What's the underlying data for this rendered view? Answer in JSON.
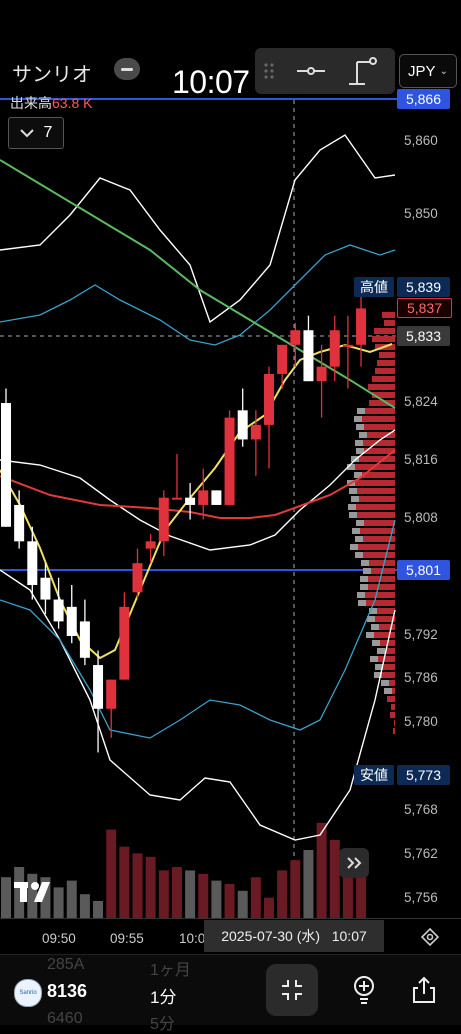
{
  "header": {
    "symbol_name": "サンリオ",
    "clock": "10:07",
    "currency": "JPY",
    "volume_label": "出来高",
    "volume_value": "63.8 K",
    "indicator_count": "7"
  },
  "price_axis": {
    "labels": [
      "5,860",
      "5,850",
      "5,824",
      "5,816",
      "5,808",
      "5,792",
      "5,786",
      "5,780",
      "5,768",
      "5,762",
      "5,756"
    ],
    "tags": {
      "upper_line": "5,866",
      "high": "5,839",
      "current": "5,837",
      "crosshair": "5,833",
      "lower_line": "5,801",
      "low": "5,773"
    },
    "high_label": "高値",
    "low_label": "安値"
  },
  "time_axis": {
    "labels": [
      "09:50",
      "09:55",
      "10:0"
    ],
    "crosshair": "2025-07-30 (水)   10:07"
  },
  "bottom_bar": {
    "stock_code": "8136",
    "interval": "1分",
    "ghost_above_code": "285A",
    "ghost_below_code": "6460",
    "ghost_above_interval": "1ヶ月",
    "ghost_below_interval": "5分"
  },
  "colors": {
    "up": "#e0323c",
    "down": "#ffffff",
    "line_blue": "#2f55e0",
    "ma_yellow": "#f0e060",
    "ma_red": "#e03a3a",
    "ma_green": "#5cb860",
    "bb_cyan": "#3aa0c8"
  },
  "chart_data": {
    "type": "candlestick",
    "interval": "1分",
    "candles": [
      {
        "o": 5824,
        "h": 5826,
        "l": 5809,
        "c": 5807
      },
      {
        "o": 5810,
        "h": 5812,
        "l": 5804,
        "c": 5805
      },
      {
        "o": 5805,
        "h": 5807,
        "l": 5797,
        "c": 5799
      },
      {
        "o": 5800,
        "h": 5802,
        "l": 5795,
        "c": 5797
      },
      {
        "o": 5797,
        "h": 5800,
        "l": 5793,
        "c": 5794
      },
      {
        "o": 5796,
        "h": 5799,
        "l": 5791,
        "c": 5792
      },
      {
        "o": 5794,
        "h": 5797,
        "l": 5788,
        "c": 5789
      },
      {
        "o": 5788,
        "h": 5790,
        "l": 5776,
        "c": 5782
      },
      {
        "o": 5782,
        "h": 5786,
        "l": 5778,
        "c": 5786
      },
      {
        "o": 5786,
        "h": 5798,
        "l": 5786,
        "c": 5796
      },
      {
        "o": 5798,
        "h": 5804,
        "l": 5797,
        "c": 5802
      },
      {
        "o": 5804,
        "h": 5806,
        "l": 5802,
        "c": 5805
      },
      {
        "o": 5805,
        "h": 5812,
        "l": 5803,
        "c": 5811
      },
      {
        "o": 5811,
        "h": 5817,
        "l": 5811,
        "c": 5811
      },
      {
        "o": 5811,
        "h": 5813,
        "l": 5808,
        "c": 5810
      },
      {
        "o": 5810,
        "h": 5815,
        "l": 5808,
        "c": 5812
      },
      {
        "o": 5812,
        "h": 5811,
        "l": 5810,
        "c": 5810
      },
      {
        "o": 5810,
        "h": 5823,
        "l": 5810,
        "c": 5822
      },
      {
        "o": 5823,
        "h": 5826,
        "l": 5818,
        "c": 5819
      },
      {
        "o": 5819,
        "h": 5823,
        "l": 5814,
        "c": 5821
      },
      {
        "o": 5821,
        "h": 5829,
        "l": 5815,
        "c": 5828
      },
      {
        "o": 5828,
        "h": 5831,
        "l": 5826,
        "c": 5832
      },
      {
        "o": 5832,
        "h": 5835,
        "l": 5829,
        "c": 5834
      },
      {
        "o": 5834,
        "h": 5836,
        "l": 5830,
        "c": 5827
      },
      {
        "o": 5827,
        "h": 5832,
        "l": 5822,
        "c": 5829
      },
      {
        "o": 5829,
        "h": 5836,
        "l": 5827,
        "c": 5834
      },
      {
        "o": 5832,
        "h": 5836,
        "l": 5826,
        "c": 5832
      },
      {
        "o": 5832,
        "h": 5839,
        "l": 5829,
        "c": 5837
      }
    ],
    "volume": [
      24,
      30,
      26,
      24,
      18,
      22,
      14,
      10,
      52,
      42,
      38,
      36,
      28,
      30,
      28,
      26,
      22,
      20,
      16,
      24,
      12,
      28,
      34,
      40,
      56,
      46,
      40,
      32
    ]
  }
}
